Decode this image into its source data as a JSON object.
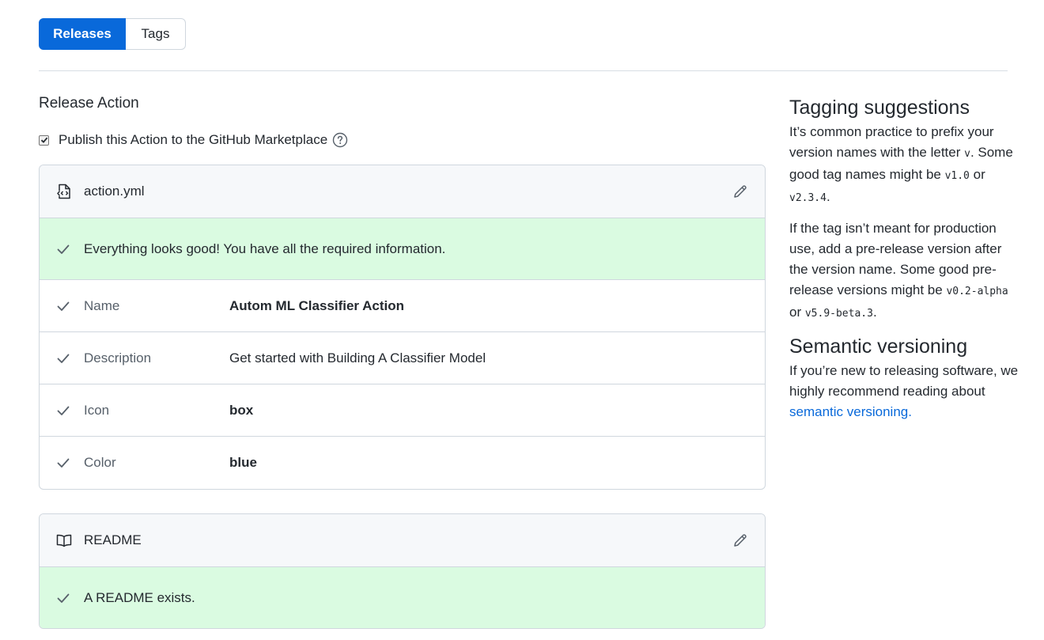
{
  "tabs": {
    "releases": "Releases",
    "tags": "Tags"
  },
  "release_action": {
    "title": "Release Action",
    "publish_label": "Publish this Action to the GitHub Marketplace",
    "publish_checked": true
  },
  "action_card": {
    "file_name": "action.yml",
    "success_message": "Everything looks good! You have all the required information.",
    "rows": [
      {
        "key": "Name",
        "value": "Autom ML Classifier Action"
      },
      {
        "key": "Description",
        "value": "Get started with Building A Classifier Model"
      },
      {
        "key": "Icon",
        "value": "box"
      },
      {
        "key": "Color",
        "value": "blue"
      }
    ]
  },
  "readme_card": {
    "file_name": "README",
    "success_message": "A README exists."
  },
  "sidebar": {
    "tagging_title": "Tagging suggestions",
    "tagging_p1_a": "It’s common practice to prefix your version names with the letter ",
    "tagging_p1_code1": "v",
    "tagging_p1_b": ". Some good tag names might be ",
    "tagging_p1_code2": "v1.0",
    "tagging_p1_c": " or ",
    "tagging_p1_code3": "v2.3.4",
    "tagging_p1_d": ".",
    "tagging_p2_a": "If the tag isn’t meant for production use, add a pre-release version after the version name. Some good pre-release versions might be ",
    "tagging_p2_code1": "v0.2-alpha",
    "tagging_p2_b": " or ",
    "tagging_p2_code2": "v5.9-beta.3",
    "tagging_p2_c": ".",
    "semver_title": "Semantic versioning",
    "semver_p_a": "If you’re new to releasing software, we highly recommend reading about ",
    "semver_link": "semantic versioning."
  },
  "colors": {
    "accent": "#0969da",
    "success_bg": "#dafbe1",
    "check": "#57606a"
  }
}
